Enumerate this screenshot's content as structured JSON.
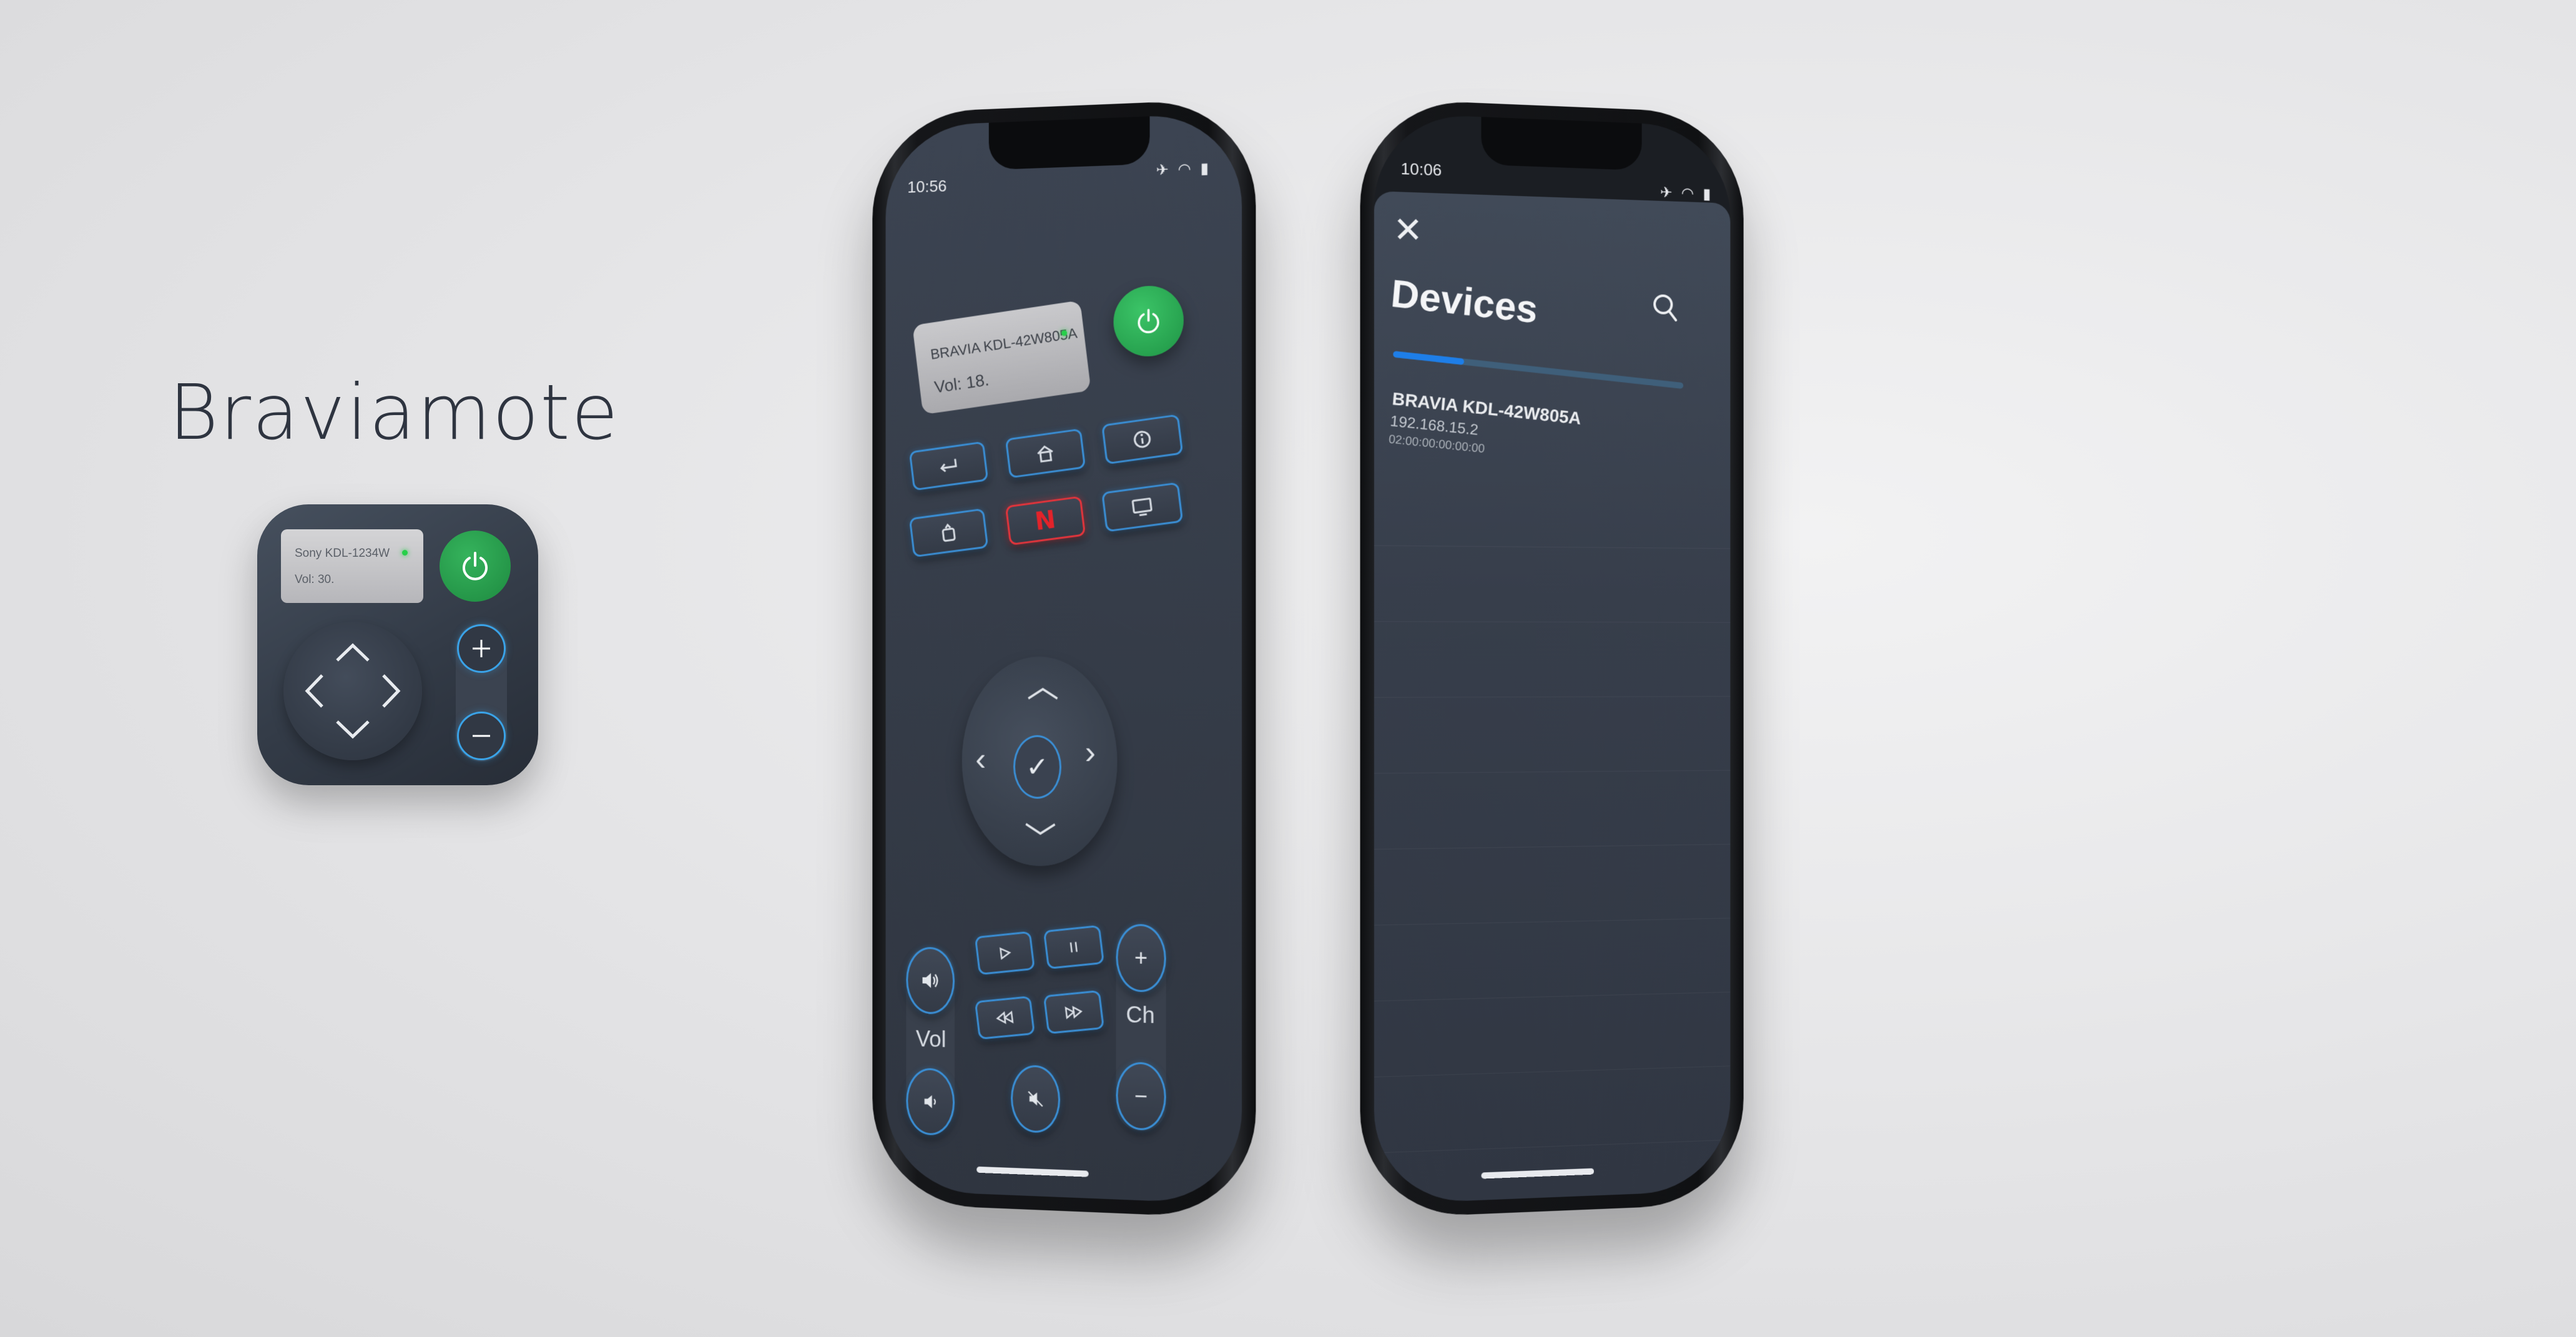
{
  "brand": {
    "app_name": "Braviamote"
  },
  "app_icon": {
    "device_model": "Sony KDL-1234W",
    "volume_text": "Vol: 30."
  },
  "remote_screen": {
    "status_time": "10:56",
    "tv_model": "BRAVIA KDL-42W805A",
    "volume_text": "Vol: 18.",
    "icons": [
      "power-icon",
      "back-icon",
      "home-icon",
      "info-icon",
      "input-icon",
      "netflix-icon",
      "tv-icon",
      "up-arrow-icon",
      "left-arrow-icon",
      "right-arrow-icon",
      "down-arrow-icon",
      "checkmark-icon",
      "volume-up-icon",
      "volume-down-icon",
      "play-icon",
      "pause-icon",
      "rewind-icon",
      "fast-forward-icon",
      "mute-icon",
      "plus-icon",
      "minus-icon"
    ],
    "vol_label": "Vol",
    "ch_label": "Ch",
    "ch_plus": "+",
    "ch_minus": "−",
    "ok_glyph": "✓",
    "netflix_letter": "N"
  },
  "devices_screen": {
    "status_time": "10:06",
    "title": "Devices",
    "scan_progress": 0.24,
    "devices": [
      {
        "name": "BRAVIA KDL-42W805A",
        "ip": "192.168.15.2",
        "mac": "02:00:00:00:00:00"
      }
    ]
  },
  "colors": {
    "accent_blue": "#3a8fd6",
    "power_green": "#1f9445",
    "netflix_red": "#e3232a",
    "screen_bg": "#353c48"
  }
}
